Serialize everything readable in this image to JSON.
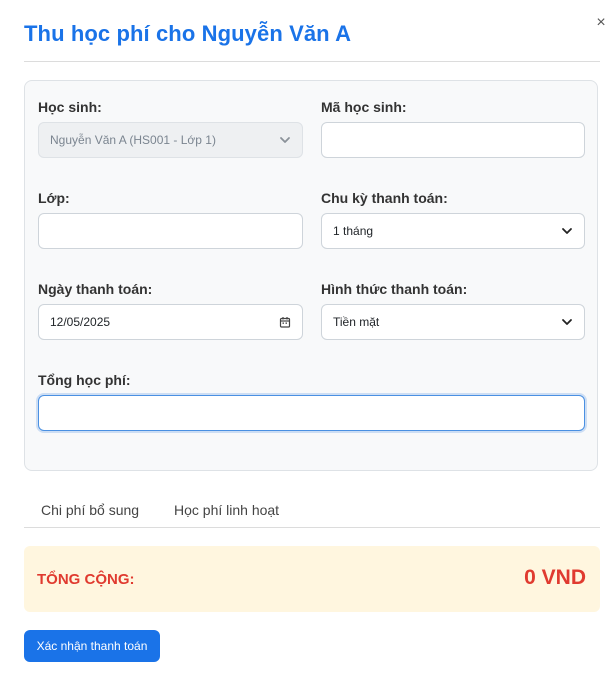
{
  "modal": {
    "title": "Thu học phí cho Nguyễn Văn A",
    "close_glyph": "×"
  },
  "form": {
    "student": {
      "label": "Học sinh:",
      "value": "Nguyễn Văn A (HS001 - Lớp 1)",
      "disabled": true
    },
    "student_id": {
      "label": "Mã học sinh:",
      "value": ""
    },
    "class": {
      "label": "Lớp:",
      "value": ""
    },
    "payment_cycle": {
      "label": "Chu kỳ thanh toán:",
      "value": "1 tháng"
    },
    "payment_date": {
      "label": "Ngày thanh toán:",
      "value": "12/05/2025"
    },
    "payment_method": {
      "label": "Hình thức thanh toán:",
      "value": "Tiền mặt"
    },
    "total_fee": {
      "label": "Tổng học phí:",
      "value": ""
    }
  },
  "tabs": [
    {
      "label": "Chi phí bổ sung"
    },
    {
      "label": "Học phí linh hoạt"
    }
  ],
  "summary": {
    "label": "TỔNG CỘNG:",
    "amount": "0",
    "currency": "VND"
  },
  "actions": {
    "confirm_label": "Xác nhận thanh toán"
  },
  "colors": {
    "accent": "#1a73e8",
    "total_text": "#e03a2f",
    "total_bg": "#fff6df"
  },
  "icons": {
    "close": "close-icon",
    "select": "chevron-down-icon",
    "date": "calendar-icon"
  }
}
